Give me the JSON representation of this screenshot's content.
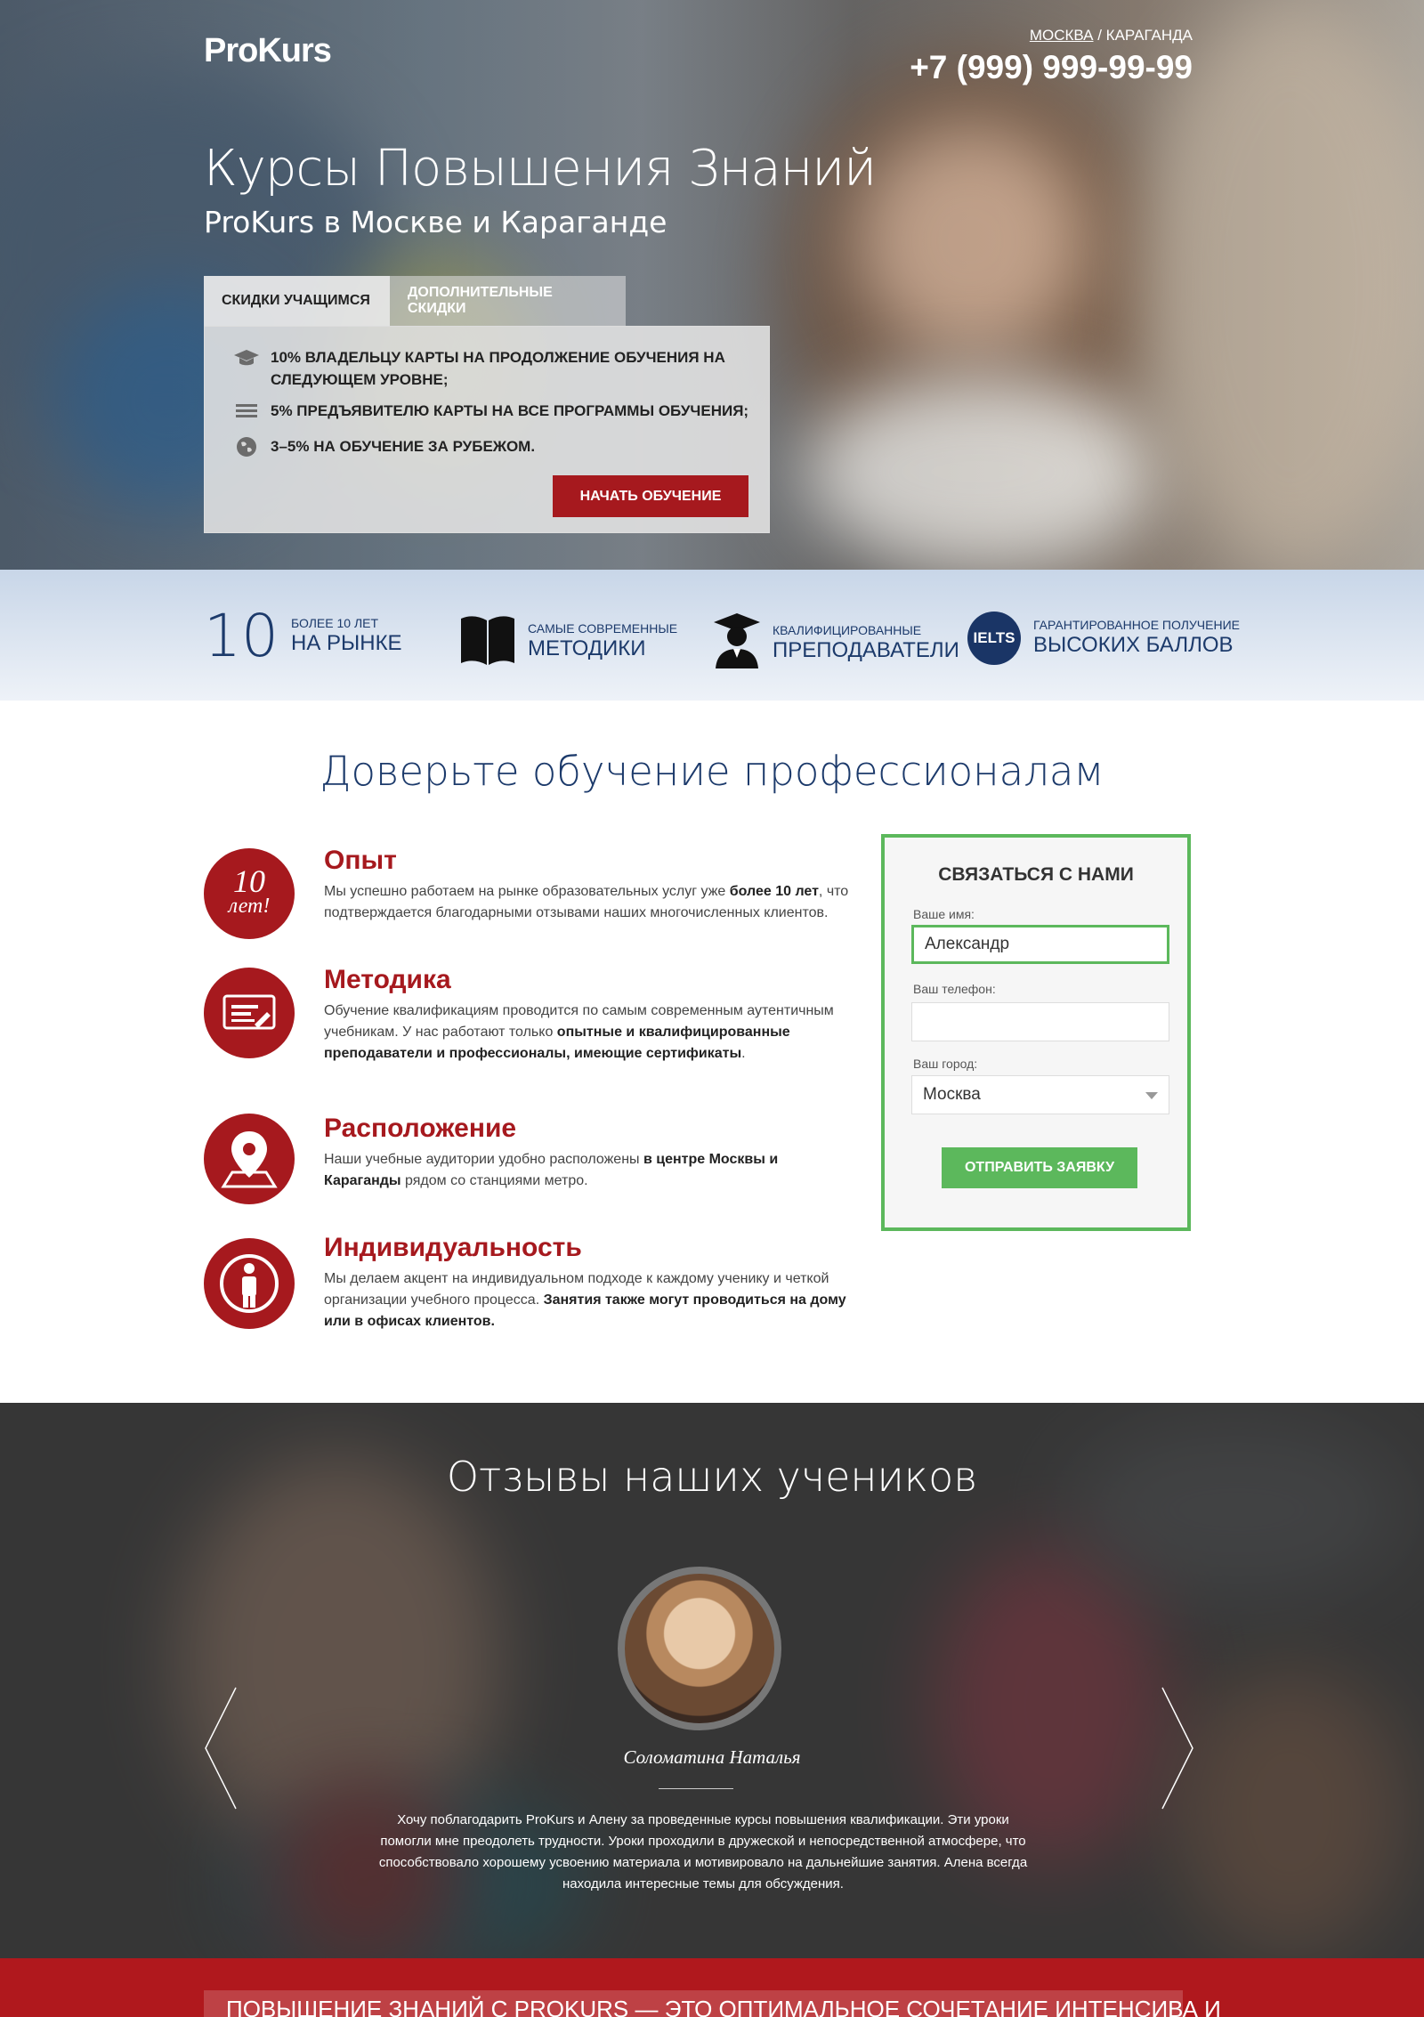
{
  "header": {
    "logo": "ProKurs",
    "city_selected": "МОСКВА",
    "city_sep": " / ",
    "city_other": "КАРАГАНДА",
    "phone": "+7 (999) 999-99-99"
  },
  "hero": {
    "title": "Курсы Повышения Знаний",
    "subtitle": "ProKurs в Москве и Караганде",
    "tabs": [
      {
        "label": "СКИДКИ УЧАЩИМСЯ"
      },
      {
        "label": "ДОПОЛНИТЕЛЬНЫЕ СКИДКИ"
      }
    ],
    "discounts": [
      {
        "icon": "graduation-cap-icon",
        "text": "10% владельцу карты на продолжение обучения на следующем уровне;"
      },
      {
        "icon": "list-icon",
        "text": "5% предъявителю карты на все программы обучения;"
      },
      {
        "icon": "globe-icon",
        "text": "3–5% на обучение за рубежом."
      }
    ],
    "start_button": "НАЧАТЬ ОБУЧЕНИЕ"
  },
  "features": [
    {
      "number": "10",
      "small": "БОЛЕЕ 10 ЛЕТ",
      "big": "НА РЫНКЕ"
    },
    {
      "icon": "book-icon",
      "small": "САМЫЕ СОВРЕМЕННЫЕ",
      "big": "МЕТОДИКИ"
    },
    {
      "icon": "teacher-icon",
      "small": "КВАЛИФИЦИРОВАННЫЕ",
      "big": "ПРЕПОДАВАТЕЛИ"
    },
    {
      "badge": "IELTS",
      "small": "ГАРАНТИРОВАННОЕ ПОЛУЧЕНИЕ",
      "big": "ВЫСОКИХ БАЛЛОВ"
    }
  ],
  "trust": {
    "title": "Доверьте обучение профессионалам",
    "items": [
      {
        "icon": "ten-years-icon",
        "badge_num": "10",
        "badge_text": "лет!",
        "title": "Опыт",
        "t1": "Мы успешно работаем на рынке образовательных услуг уже ",
        "b1": "более 10 лет",
        "t2": ", что подтверждается благодарными отзывами наших многочисленных клиентов."
      },
      {
        "icon": "certificate-icon",
        "title": "Методика",
        "t1": "Обучение квалификациям проводится по самым современным аутентичным учебникам. У нас работают только ",
        "b1": "опытные и квалифицированные преподаватели и профессионалы, имеющие сертификаты",
        "t2": "."
      },
      {
        "icon": "map-pin-icon",
        "title": "Расположение",
        "t1": "Наши учебные аудитории удобно расположены ",
        "b1": "в центре Москвы и Караганды",
        "t2": " рядом со станциями метро."
      },
      {
        "icon": "person-icon",
        "title": "Индивидуальность",
        "t1": "Мы делаем акцент на индивидуальном подходе к каждому ученику и четкой организации учебного процесса. ",
        "b1": "Занятия также могут проводиться на дому или в офисах клиентов.",
        "t2": ""
      }
    ]
  },
  "form": {
    "title": "СВЯЗАТЬСЯ С НАМИ",
    "name_label": "Ваше имя:",
    "name_value": "Александр",
    "phone_label": "Ваш телефон:",
    "phone_value": "",
    "city_label": "Ваш город:",
    "city_value": "Москва",
    "submit": "ОТПРАВИТЬ ЗАЯВКУ"
  },
  "reviews": {
    "title": "Отзывы наших учеников",
    "name": "Соломатина Наталья",
    "text": "Хочу поблагодарить ProKurs и Алену за проведенные курсы повышения квалификации. Эти уроки помогли мне преодолеть трудности. Уроки проходили в дружеской и непосредственной атмосфере, что способствовало хорошему усвоению материала и мотивировало на дальнейшие занятия. Алена всегда находила интересные темы для обсуждения."
  },
  "bottom": {
    "text": "ПОВЫШЕНИЕ ЗНАНИЙ С PROKURS — ЭТО ОПТИМАЛЬНОЕ СОЧЕТАНИЕ ИНТЕНСИВА И"
  },
  "colors": {
    "brand_red": "#a6191e",
    "navy": "#1c3a6b",
    "green": "#5cb85c"
  }
}
